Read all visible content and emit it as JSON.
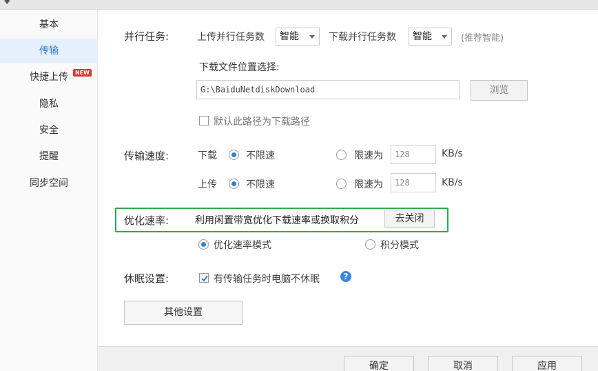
{
  "sidebar": {
    "items": [
      {
        "label": "基本"
      },
      {
        "label": "传输"
      },
      {
        "label": "快捷上传"
      },
      {
        "label": "隐私"
      },
      {
        "label": "安全"
      },
      {
        "label": "提醒"
      },
      {
        "label": "同步空间"
      }
    ],
    "new_badge": "NEW",
    "active_index": 1
  },
  "parallel": {
    "label": "并行任务:",
    "upload_label": "上传并行任务数",
    "upload_value": "智能",
    "download_label": "下载并行任务数",
    "download_value": "智能",
    "hint": "(推荐智能)"
  },
  "download_location": {
    "label": "下载文件位置选择:",
    "path": "G:\\BaiduNetdiskDownload",
    "browse_label": "浏览",
    "default_checkbox_label": "默认此路径为下载路径",
    "default_checked": false
  },
  "speed": {
    "label": "传输速度:",
    "download": {
      "label": "下载",
      "unlimited_label": "不限速",
      "limit_label": "限速为",
      "limit_value": "128",
      "unit": "KB/s",
      "selected": "unlimited"
    },
    "upload": {
      "label": "上传",
      "unlimited_label": "不限速",
      "limit_label": "限速为",
      "limit_value": "128",
      "unit": "KB/s",
      "selected": "unlimited"
    }
  },
  "optimize": {
    "label": "优化速率:",
    "description": "利用闲置带宽优化下载速率或换取积分",
    "button_label": "去关闭",
    "mode_speed_label": "优化速率模式",
    "mode_points_label": "积分模式",
    "selected_mode": "speed",
    "highlight_color": "#2fa84f"
  },
  "sleep": {
    "label": "休眠设置:",
    "checkbox_label": "有传输任务时电脑不休眠",
    "checked": true,
    "help_icon": "question-icon",
    "help_glyph": "?"
  },
  "other_settings_label": "其他设置",
  "footer": {
    "ok_label": "确定",
    "cancel_label": "取消",
    "apply_label": "应用"
  },
  "colors": {
    "accent": "#2f7fd8",
    "active_bg": "#e4f0fb",
    "badge": "#e0352a"
  }
}
